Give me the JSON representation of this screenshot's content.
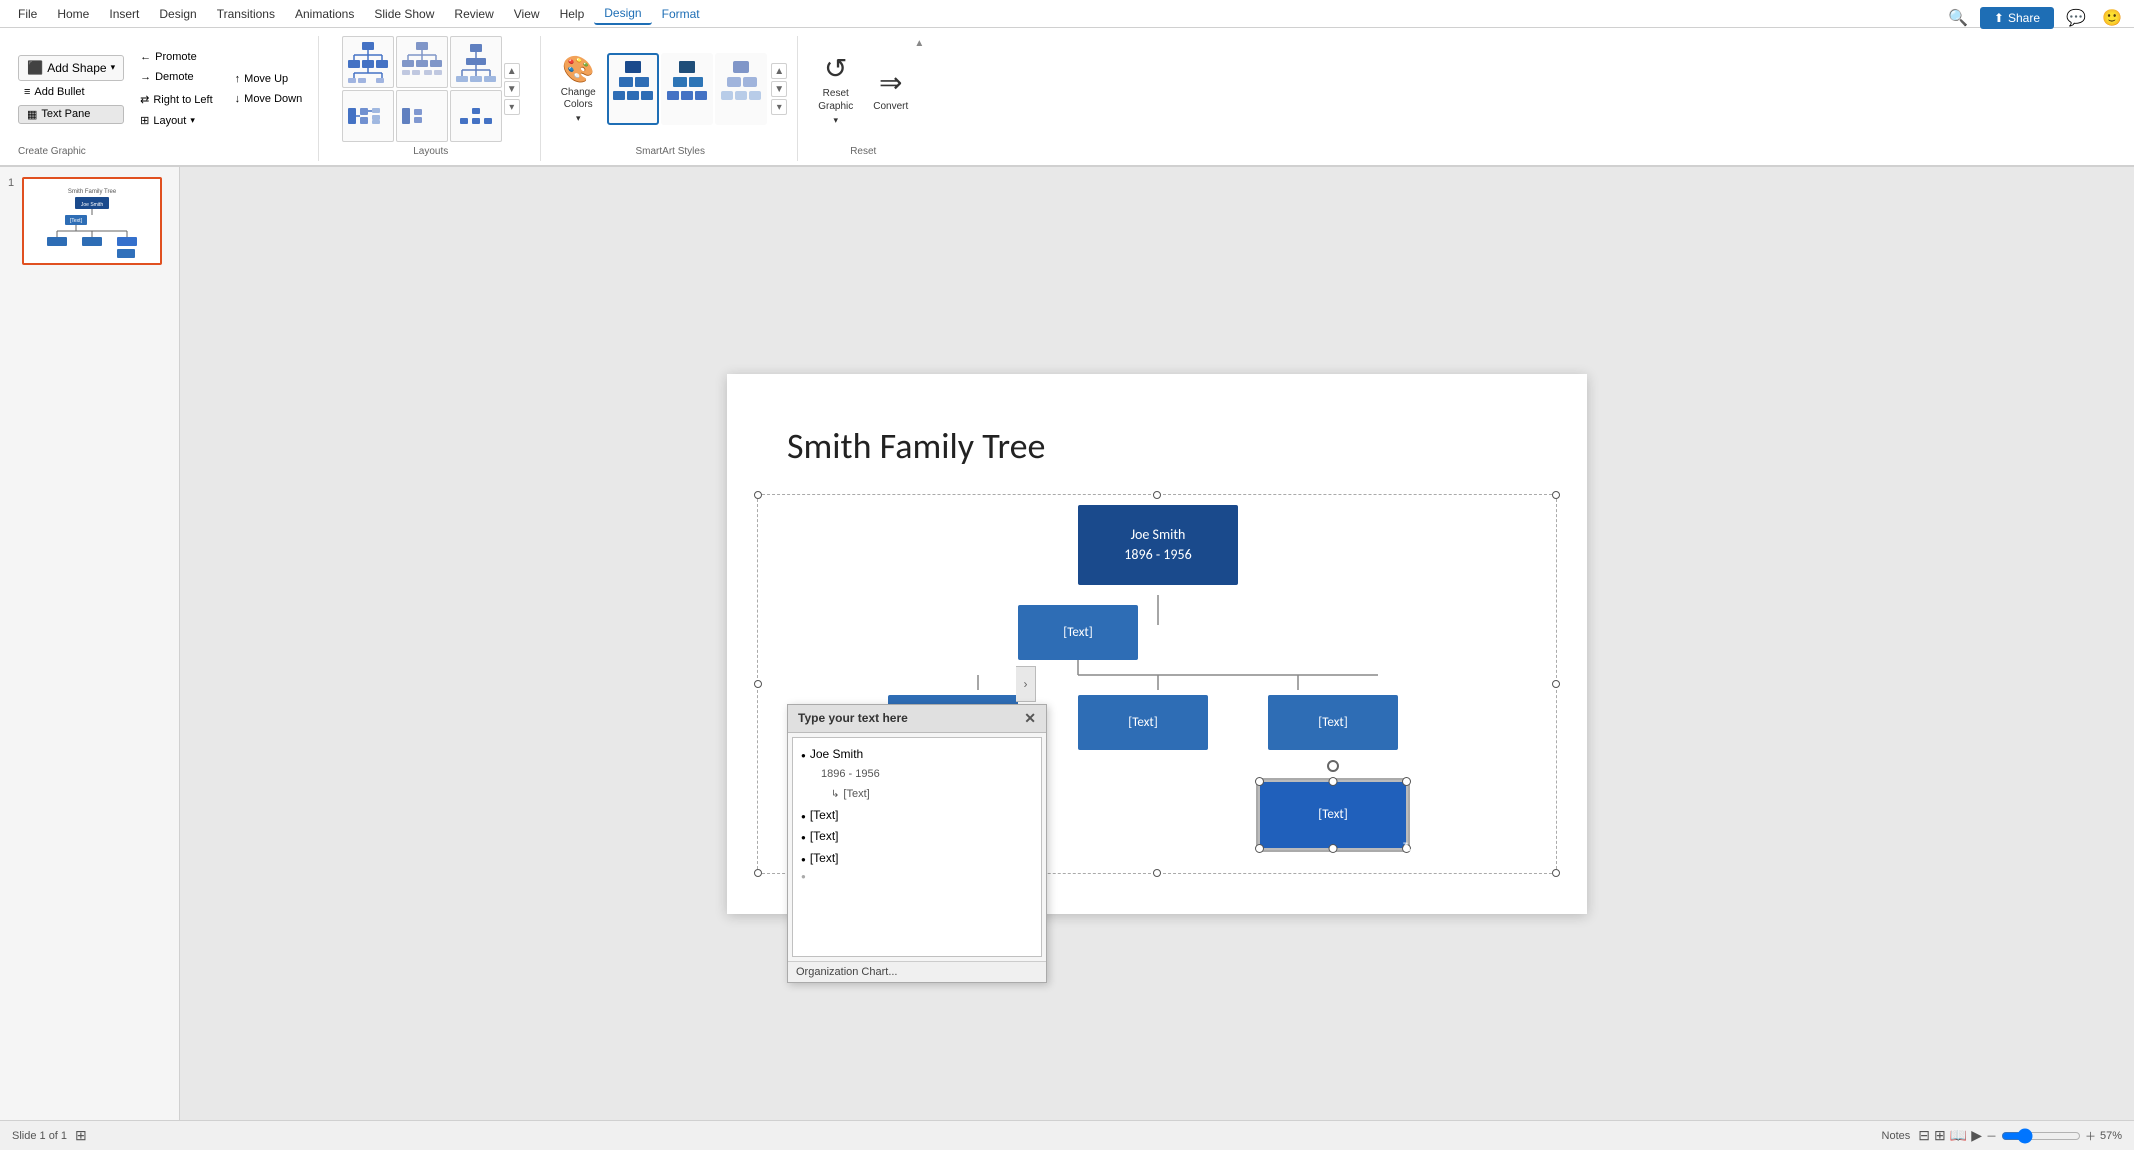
{
  "menubar": {
    "items": [
      "File",
      "Home",
      "Insert",
      "Design",
      "Transitions",
      "Animations",
      "Slide Show",
      "Review",
      "View",
      "Help",
      "Design",
      "Format"
    ],
    "active": "Design",
    "format": "Format"
  },
  "ribbon": {
    "createGraphic": {
      "label": "Create Graphic",
      "addShape": "Add Shape",
      "addBullet": "Add Bullet",
      "textPane": "Text Pane",
      "promote": "Promote",
      "demote": "Demote",
      "moveUp": "Move Up",
      "moveDown": "Move Down",
      "rightToLeft": "Right to Left",
      "layout": "Layout"
    },
    "layouts": {
      "label": "Layouts"
    },
    "smartartStyles": {
      "label": "SmartArt Styles"
    },
    "reset": {
      "label": "Reset",
      "resetGraphic": "Reset\nGraphic",
      "convert": "Convert"
    }
  },
  "share": {
    "label": "Share"
  },
  "textPane": {
    "title": "Type your text here",
    "items": [
      {
        "text": "Joe Smith",
        "level": 0
      },
      {
        "text": "1896 - 1956",
        "level": 1
      },
      {
        "text": "[Text]",
        "level": 2
      },
      {
        "text": "[Text]",
        "level": 1
      },
      {
        "text": "[Text]",
        "level": 1
      },
      {
        "text": "[Text]",
        "level": 1
      }
    ],
    "orgChartLink": "Organization Chart..."
  },
  "slide": {
    "title": "Smith Family Tree",
    "number": 1,
    "total": 1,
    "nodes": {
      "root": {
        "text": "Joe Smith\n1896 - 1956"
      },
      "child1": {
        "text": "[Text]"
      },
      "level2a": {
        "text": "[Text]"
      },
      "level2b": {
        "text": "[Text]"
      },
      "level2c": {
        "text": "[Text]"
      },
      "level3": {
        "text": "[Text]"
      }
    }
  },
  "statusBar": {
    "slideInfo": "Slide 1 of 1",
    "notes": "Notes",
    "zoom": "57%"
  }
}
